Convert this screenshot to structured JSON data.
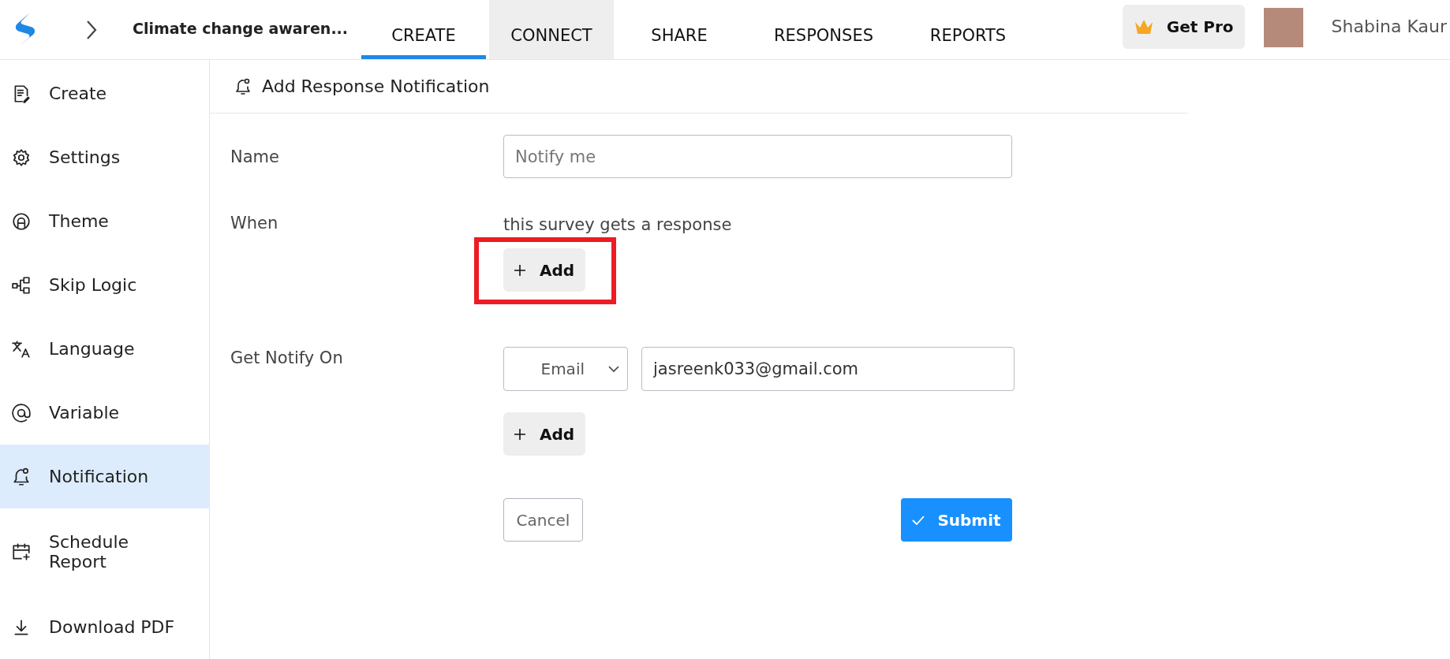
{
  "header": {
    "survey_title": "Climate change awaren...",
    "tabs": [
      {
        "label": "CREATE",
        "selected": true,
        "hovered": false
      },
      {
        "label": "CONNECT",
        "selected": false,
        "hovered": true
      },
      {
        "label": "SHARE",
        "selected": false,
        "hovered": false
      },
      {
        "label": "RESPONSES",
        "selected": false,
        "hovered": false
      },
      {
        "label": "REPORTS",
        "selected": false,
        "hovered": false
      }
    ],
    "upgrade_button": "Get Pro",
    "user_name": "Shabina Kaur"
  },
  "sidebar": {
    "items": [
      {
        "label": "Create",
        "kind": "create",
        "selected": false
      },
      {
        "label": "Settings",
        "kind": "settings",
        "selected": false
      },
      {
        "label": "Theme",
        "kind": "theme",
        "selected": false
      },
      {
        "label": "Skip Logic",
        "kind": "logic",
        "selected": false
      },
      {
        "label": "Language",
        "kind": "language",
        "selected": false
      },
      {
        "label": "Variable",
        "kind": "variable",
        "selected": false
      },
      {
        "label": "Notification",
        "kind": "notification",
        "selected": true
      },
      {
        "label": "Schedule\nReport",
        "kind": "schedule",
        "selected": false
      },
      {
        "label": "Download PDF",
        "kind": "download",
        "selected": false
      }
    ]
  },
  "panel": {
    "title": "Add Response Notification",
    "name_field": {
      "label": "Name",
      "placeholder": "Notify me"
    },
    "when": {
      "label": "When",
      "condition": "this survey gets a response",
      "add_button": {
        "label": "Add",
        "highlighted": true
      }
    },
    "notify_on": {
      "label": "Get Notify On",
      "channel": "Email",
      "address": "jasreenk033@gmail.com",
      "add_button": {
        "label": "Add"
      }
    },
    "cancel_button": "Cancel",
    "submit_button": "Submit"
  }
}
